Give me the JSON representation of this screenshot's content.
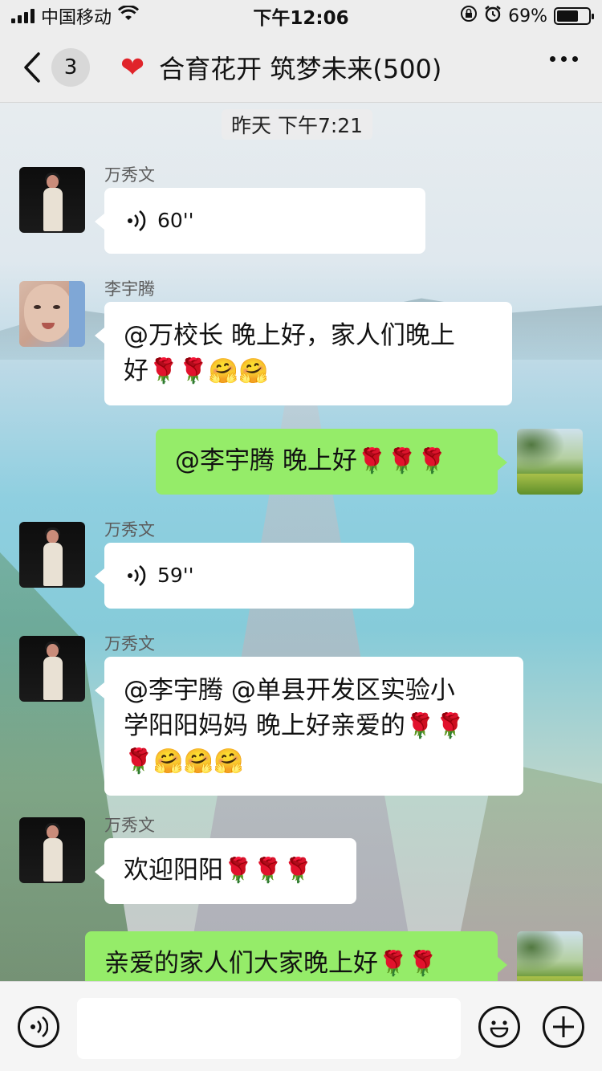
{
  "status_bar": {
    "carrier": "中国移动",
    "time": "下午12:06",
    "battery_percent": "69%",
    "battery_level": 0.69
  },
  "nav": {
    "unread_count": "3",
    "group_title": "合育花开 筑梦未来(500)"
  },
  "chat": {
    "timestamp": "昨天 下午7:21",
    "messages": [
      {
        "sender": "万秀文",
        "type": "voice",
        "duration": "60''"
      },
      {
        "sender": "李宇腾",
        "type": "text",
        "line1": "@万校长 晚上好，家人们晚上",
        "line2": "好",
        "emoji": "🌹🌹🤗🤗"
      },
      {
        "sender": "me",
        "type": "text",
        "text": "@李宇腾 晚上好",
        "emoji": "🌹🌹🌹"
      },
      {
        "sender": "万秀文",
        "type": "voice",
        "duration": "59''"
      },
      {
        "sender": "万秀文",
        "type": "text",
        "line1": "@李宇腾 @单县开发区实验小",
        "line2": "学阳阳妈妈 晚上好亲爱的",
        "line2_emoji": "🌹🌹",
        "line3_emoji": "🌹🤗🤗🤗"
      },
      {
        "sender": "万秀文",
        "type": "text",
        "text": "欢迎阳阳",
        "emoji": "🌹🌹🌹"
      },
      {
        "sender": "me",
        "type": "text",
        "text": "亲爱的家人们大家晚上好",
        "emoji": "🌹🌹"
      }
    ]
  },
  "input_bar": {
    "placeholder": ""
  },
  "colors": {
    "outgoing_bubble": "#95ec69",
    "incoming_bubble": "#ffffff",
    "heart": "#e0242a"
  }
}
